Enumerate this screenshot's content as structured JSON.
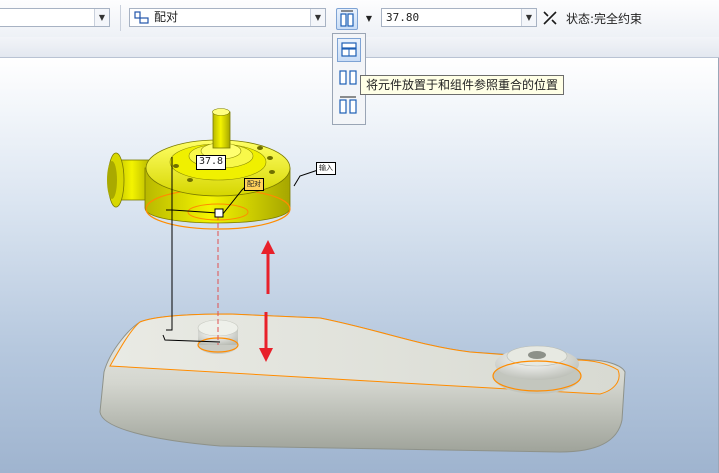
{
  "toolbar": {
    "first_combo_value": "",
    "constraint_type": "配对",
    "offset_value": "37.80",
    "status_text": "状态:完全约束"
  },
  "flyout": {
    "tooltip": "将元件放置于和组件参照重合的位置"
  },
  "viewport": {
    "dimension_label": "37.8",
    "constraint_tag": "配对",
    "note_tag": "输入"
  },
  "colors": {
    "toolbar_bg": "#eef1f6",
    "part_yellow": "#e6e600",
    "base_gray": "#d9dbd4",
    "highlight_orange": "#ff8c00",
    "arrow_red": "#e8202a",
    "viewport_bottom": "#9fb4cf"
  }
}
